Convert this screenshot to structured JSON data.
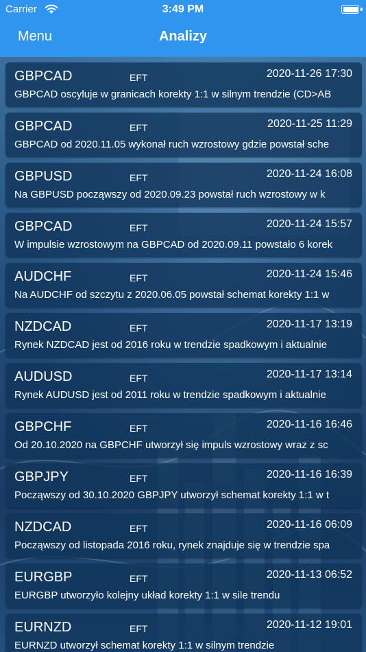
{
  "status_bar": {
    "carrier": "Carrier",
    "time": "3:49 PM"
  },
  "nav": {
    "menu_label": "Menu",
    "title": "Analizy"
  },
  "colors": {
    "header": "#2f95ef",
    "card": "#10345a"
  },
  "analyses": [
    {
      "pair": "GBPCAD",
      "tag": "EFT",
      "date": "2020-11-26 17:30",
      "summary": "GBPCAD oscyluje w granicach korekty 1:1 w silnym trendzie (CD>AB"
    },
    {
      "pair": "GBPCAD",
      "tag": "EFT",
      "date": "2020-11-25 11:29",
      "summary": "GBPCAD od 2020.11.05 wykonał ruch wzrostowy gdzie powstał sche"
    },
    {
      "pair": "GBPUSD",
      "tag": "EFT",
      "date": "2020-11-24 16:08",
      "summary": "Na GBPUSD począwszy od 2020.09.23 powstał ruch wzrostowy w k"
    },
    {
      "pair": "GBPCAD",
      "tag": "EFT",
      "date": "2020-11-24 15:57",
      "summary": "W impulsie wzrostowym na GBPCAD od 2020.09.11 powstało 6 korek"
    },
    {
      "pair": "AUDCHF",
      "tag": "EFT",
      "date": "2020-11-24 15:46",
      "summary": "Na AUDCHF od szczytu z 2020.06.05 powstał schemat korekty 1:1 w"
    },
    {
      "pair": "NZDCAD",
      "tag": "EFT",
      "date": "2020-11-17 13:19",
      "summary": "Rynek NZDCAD jest od 2016 roku w trendzie spadkowym i aktualnie"
    },
    {
      "pair": "AUDUSD",
      "tag": "EFT",
      "date": "2020-11-17 13:14",
      "summary": "Rynek AUDUSD jest od 2011 roku w trendzie spadkowym i aktualnie"
    },
    {
      "pair": "GBPCHF",
      "tag": "EFT",
      "date": "2020-11-16 16:46",
      "summary": "Od 20.10.2020 na GBPCHF utworzył się impuls wzrostowy wraz z sc"
    },
    {
      "pair": "GBPJPY",
      "tag": "EFT",
      "date": "2020-11-16 16:39",
      "summary": "Począwszy od 30.10.2020 GBPJPY utworzył schemat korekty 1:1 w t"
    },
    {
      "pair": "NZDCAD",
      "tag": "EFT",
      "date": "2020-11-16 06:09",
      "summary": "Począwszy od listopada 2016 roku, rynek znajduje się w trendzie spa"
    },
    {
      "pair": "EURGBP",
      "tag": "EFT",
      "date": "2020-11-13 06:52",
      "summary": "EURGBP utworzyło kolejny układ korekty 1:1 w sile trendu"
    },
    {
      "pair": "EURNZD",
      "tag": "EFT",
      "date": "2020-11-12 19:01",
      "summary": "EURNZD utworzył schemat korekty 1:1 w silnym trendzie"
    }
  ]
}
